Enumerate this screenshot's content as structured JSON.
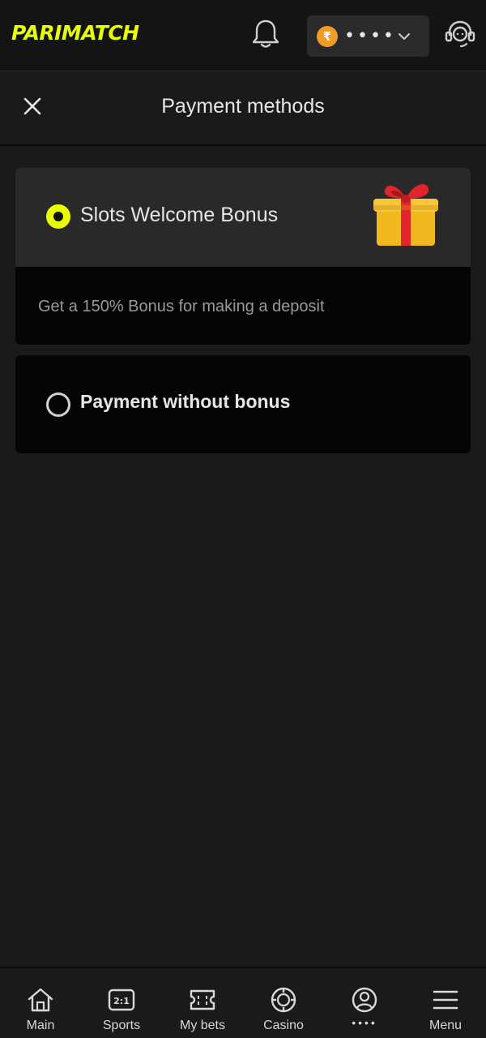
{
  "header": {
    "logo": "PARIMATCH",
    "currency_symbol": "₹",
    "balance_masked": "••••"
  },
  "page": {
    "title": "Payment methods"
  },
  "options": [
    {
      "label": "Slots Welcome Bonus",
      "selected": true,
      "description": "Get a 150% Bonus for making a deposit",
      "icon": "gift-box-icon"
    },
    {
      "label": "Payment without bonus",
      "selected": false
    }
  ],
  "bottom_nav": {
    "items": [
      {
        "label": "Main",
        "icon": "home-icon"
      },
      {
        "label": "Sports",
        "icon": "scoreboard-icon"
      },
      {
        "label": "My bets",
        "icon": "ticket-icon"
      },
      {
        "label": "Casino",
        "icon": "chip-icon"
      },
      {
        "label": "••••",
        "icon": "profile-icon"
      },
      {
        "label": "Menu",
        "icon": "menu-icon"
      }
    ]
  },
  "colors": {
    "accent": "#e8ff00",
    "coin": "#f09a2a",
    "background": "#1a1a1a",
    "card": "#292929"
  }
}
